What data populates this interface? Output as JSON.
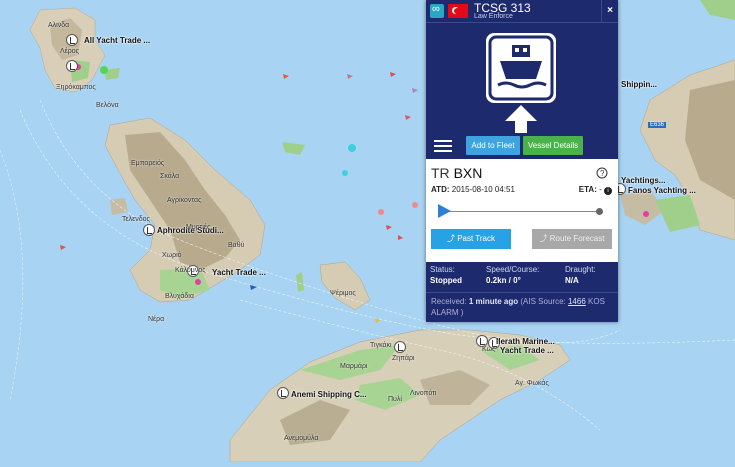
{
  "map": {
    "poi_labels": [
      "All Yacht Trade ...",
      "Aphrodite Studi...",
      "Yacht Trade ...",
      "Fanos Yachting ...",
      "Yachtings...",
      "Shippin...",
      "Ilerath Marine...",
      "Yacht Trade ...",
      "Anemi Shipping C..."
    ],
    "town_labels": [
      "Αλινδα",
      "Λέρος",
      "Ξηρόκαμπος",
      "Βελόνα",
      "Εμπορειός",
      "Σκάλα",
      "Αγρίκοντας",
      "Τελενδος",
      "Μυρτιές",
      "Βαθύ",
      "Χωριό",
      "Κάλυμνος",
      "Βλυχάδια",
      "Νέρα",
      "Ψέριμος",
      "Τιγκάκι",
      "Ζηπάρι",
      "Μαρμάρι",
      "Λινοπότι",
      "Πυλί",
      "Ανεμομύλα",
      "Αγ. Φωκάς",
      "Κως"
    ],
    "road_badge": "Ε636"
  },
  "panel": {
    "vessel_name": "TCSG 313",
    "vessel_type": "Law Enforce",
    "close_label": "×",
    "add_to_fleet": "Add to Fleet",
    "vessel_details": "Vessel Details",
    "callsign_prefix": "TR",
    "callsign_code": "BXN",
    "atd_label": "ATD:",
    "atd_value": "2015-08-10 04:51",
    "eta_label": "ETA:",
    "eta_value": "-",
    "past_track": "Past Track",
    "route_forecast": "Route Forecast",
    "status_label": "Status:",
    "status_value": "Stopped",
    "speed_label": "Speed/Course:",
    "speed_value": "0.2kn / 0°",
    "draught_label": "Draught:",
    "draught_value": "N/A",
    "received_label": "Received:",
    "received_value": "1 minute ago",
    "ais_source_prefix": "(AIS Source:",
    "ais_source_id": "1466",
    "ais_source_name": "KOS ALARM )"
  },
  "colors": {
    "panel_navy": "#1e2a6e",
    "fleet_button": "#3fa3df",
    "details_button": "#4bb24b",
    "past_track_button": "#27a2e5",
    "sea": "#a9d3f2"
  }
}
